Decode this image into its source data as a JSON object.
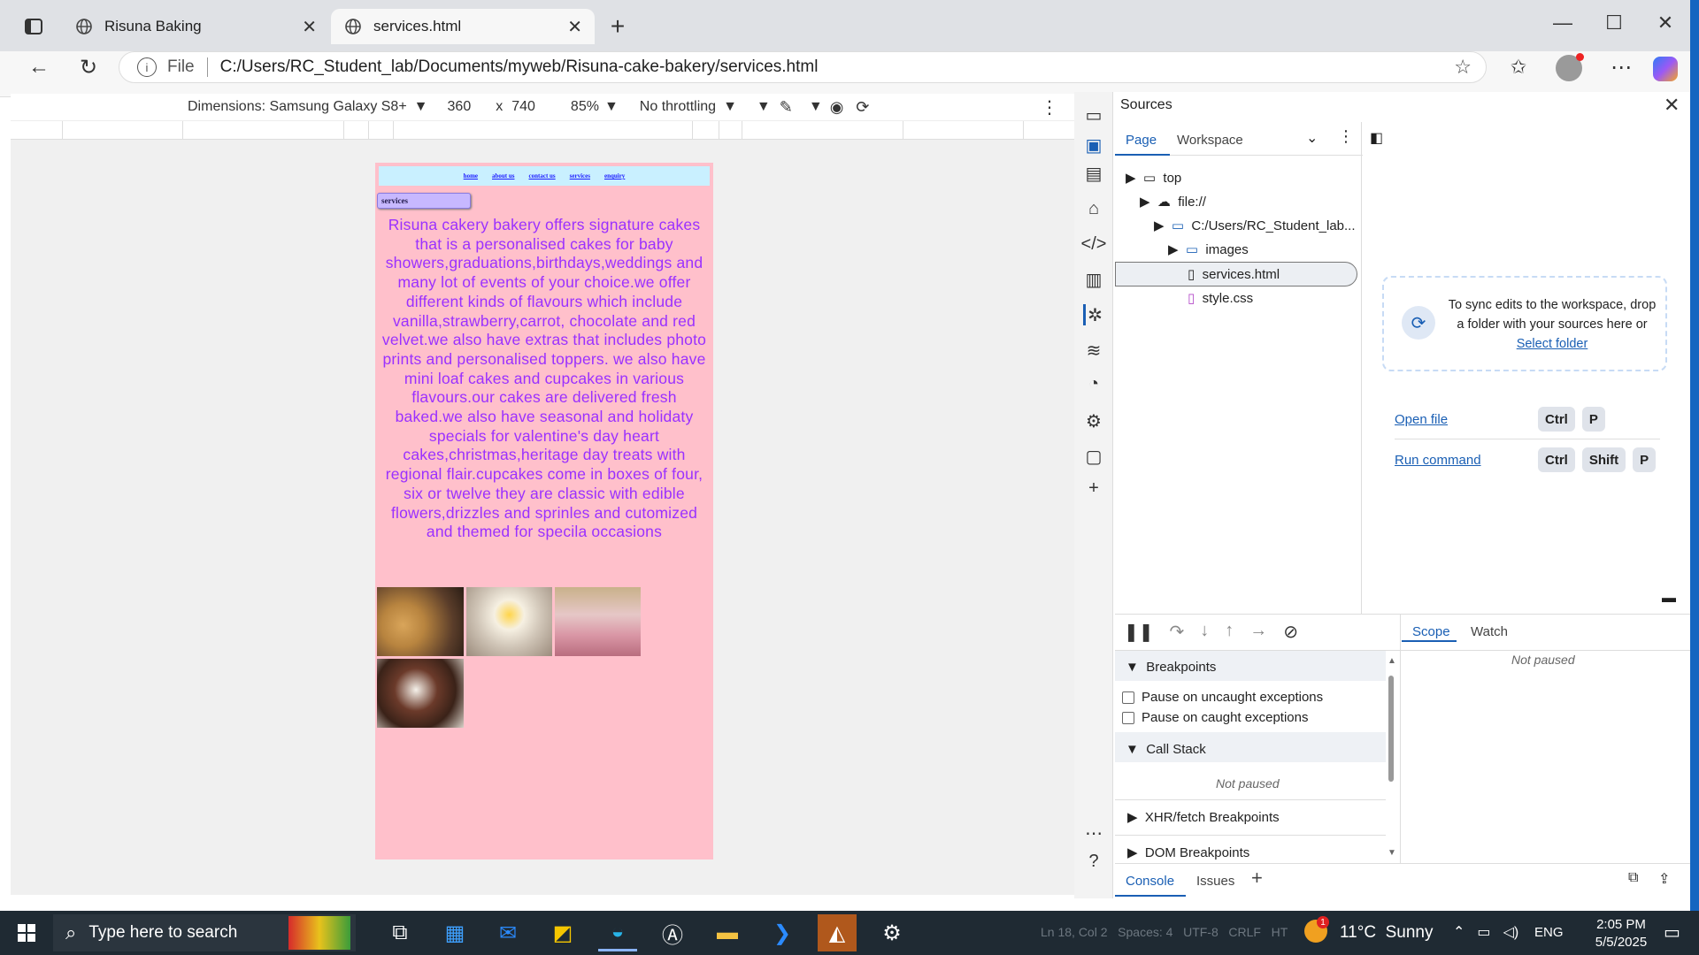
{
  "browser": {
    "tabs": [
      {
        "label": "Risuna Baking"
      },
      {
        "label": "services.html"
      }
    ],
    "address": {
      "scheme": "File",
      "url": "C:/Users/RC_Student_lab/Documents/myweb/Risuna-cake-bakery/services.html"
    }
  },
  "device_toolbar": {
    "dimensions_label": "Dimensions: Samsung Galaxy S8+",
    "width": "360",
    "times": "x",
    "height": "740",
    "zoom": "85%",
    "throttling": "No throttling"
  },
  "site": {
    "nav": [
      "home",
      "about us",
      "contact us",
      "services",
      "enquiry"
    ],
    "section_label": "services",
    "body_text": "Risuna cakery bakery offers signature cakes that is a personalised cakes for baby showers,graduations,birthdays,weddings and many lot of events of your choice.we offer different kinds of flavours which include vanilla,strawberry,carrot, chocolate and red velvet.we also have extras that includes photo prints and personalised toppers. we also have mini loaf cakes and cupcakes in various flavours.our cakes are delivered fresh baked.we also have seasonal and holidaty specials for valentine's day heart cakes,christmas,heritage day treats with regional flair.cupcakes come in boxes of four, six or twelve they are classic with edible flowers,drizzles and sprinles and cutomized and themed for specila occasions"
  },
  "devtools": {
    "panel_title": "Sources",
    "tabs": {
      "page": "Page",
      "workspace": "Workspace"
    },
    "tree": {
      "top": "top",
      "file": "file://",
      "folder": "C:/Users/RC_Student_lab...",
      "images": "images",
      "services": "services.html",
      "style": "style.css"
    },
    "workspace_msg": "To sync edits to the workspace, drop a folder with your sources here or",
    "select_folder": "Select folder",
    "open_file": "Open file",
    "run_command": "Run command",
    "keys": {
      "ctrl": "Ctrl",
      "shift": "Shift",
      "p": "P"
    },
    "scope_tab": "Scope",
    "watch_tab": "Watch",
    "not_paused": "Not paused",
    "breakpoints": "Breakpoints",
    "pause_uncaught": "Pause on uncaught exceptions",
    "pause_caught": "Pause on caught exceptions",
    "call_stack": "Call Stack",
    "call_stack_status": "Not paused",
    "xhr": "XHR/fetch Breakpoints",
    "dom": "DOM Breakpoints",
    "drawer_console": "Console",
    "drawer_issues": "Issues"
  },
  "taskbar": {
    "search_placeholder": "Type here to search",
    "weather": "11°C  Sunny",
    "weather_badge": "1",
    "language": "ENG",
    "time": "2:05 PM",
    "date": "5/5/2025",
    "bg_text": "Ln 18, Col 2   Spaces: 4   UTF-8   CRLF   HT"
  },
  "colors": {
    "page_bg": "#ffc0cb",
    "body_text": "#9b30ff",
    "nav_bar": "#c9f0ff",
    "link_blue": "#1a5fb4",
    "taskbar": "#1f2a33"
  }
}
